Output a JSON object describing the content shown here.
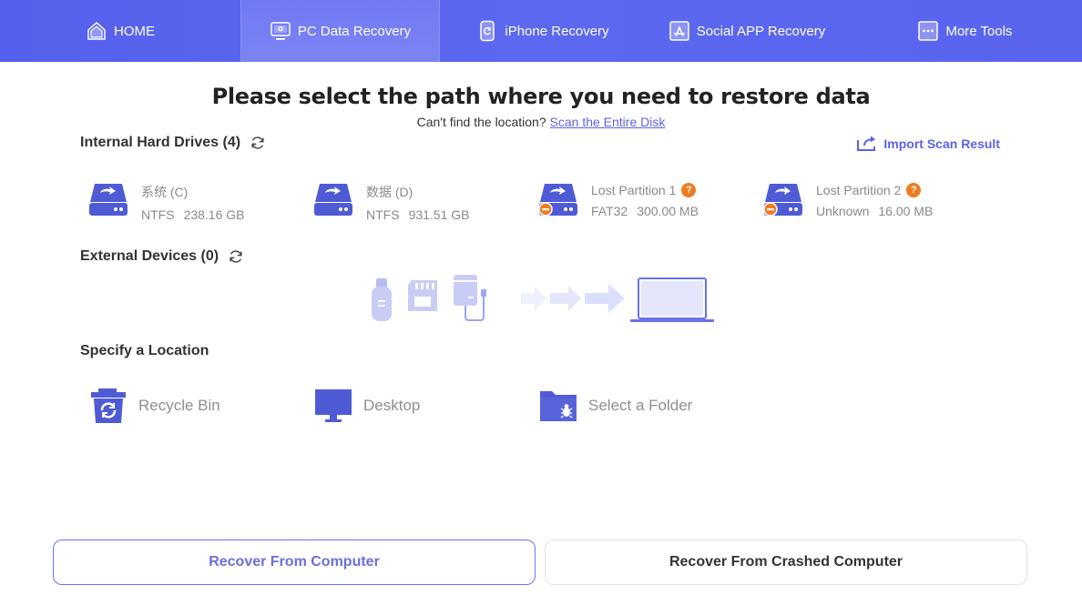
{
  "nav": {
    "tabs": [
      {
        "label": "HOME",
        "icon": "home-icon",
        "active": false
      },
      {
        "label": "PC Data Recovery",
        "icon": "pc-icon",
        "active": true
      },
      {
        "label": "iPhone Recovery",
        "icon": "phone-icon",
        "active": false
      },
      {
        "label": "Social APP Recovery",
        "icon": "app-store-icon",
        "active": false
      },
      {
        "label": "More Tools",
        "icon": "more-icon",
        "active": false
      }
    ]
  },
  "main": {
    "title": "Please select the path where you need to restore data",
    "subtitle_prefix": "Can't find the location?",
    "subtitle_link": "Scan the Entire Disk",
    "import_label": "Import Scan Result"
  },
  "internal": {
    "heading": "Internal Hard Drives (4)",
    "drives": [
      {
        "name": "系统 (C)",
        "fs": "NTFS",
        "size": "238.16 GB",
        "lost": false
      },
      {
        "name": "数据 (D)",
        "fs": "NTFS",
        "size": "931.51 GB",
        "lost": false
      },
      {
        "name": "Lost Partition 1",
        "fs": "FAT32",
        "size": "300.00 MB",
        "lost": true
      },
      {
        "name": "Lost Partition 2",
        "fs": "Unknown",
        "size": "16.00 MB",
        "lost": true
      }
    ]
  },
  "external": {
    "heading": "External Devices (0)"
  },
  "location": {
    "heading": "Specify a Location",
    "items": [
      {
        "label": "Recycle Bin",
        "icon": "recycle-bin-icon"
      },
      {
        "label": "Desktop",
        "icon": "desktop-icon"
      },
      {
        "label": "Select a Folder",
        "icon": "folder-icon"
      }
    ]
  },
  "buttons": {
    "recover_computer": "Recover From Computer",
    "recover_crashed": "Recover From Crashed Computer"
  },
  "colors": {
    "accent": "#5b63e8",
    "nav_bg": "#5a64ef",
    "warning": "#f07c22",
    "muted_text": "#8a8a8a"
  }
}
